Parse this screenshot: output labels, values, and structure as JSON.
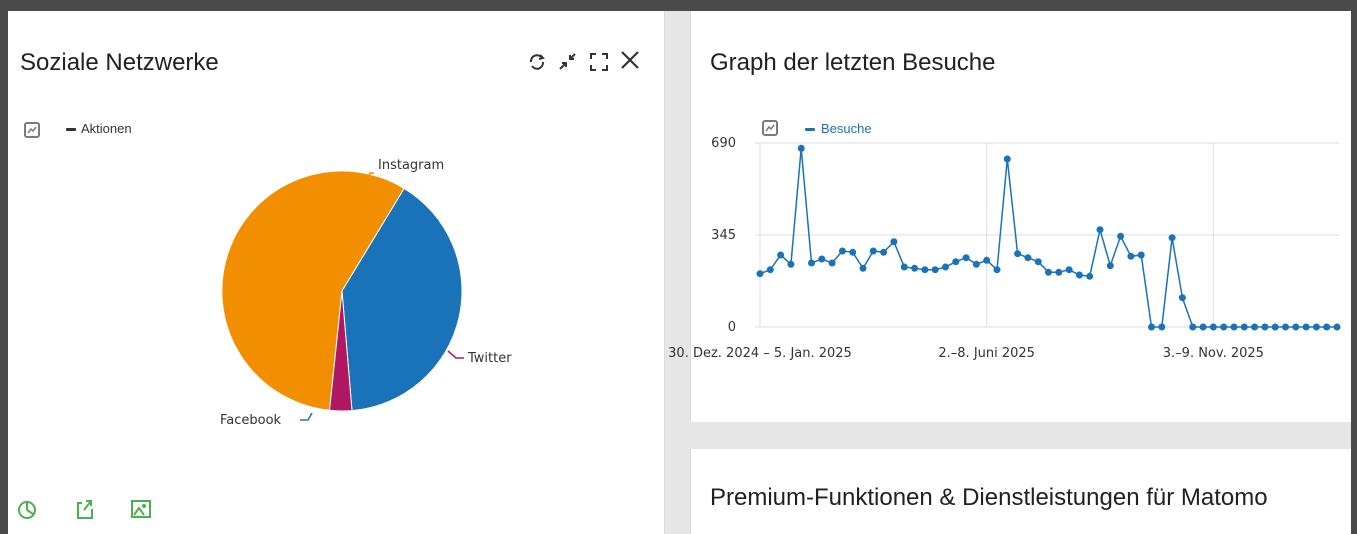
{
  "social": {
    "title": "Soziale Netzwerke",
    "legend_label": "Aktionen",
    "controls": [
      "refresh-icon",
      "minimize-icon",
      "maximize-icon",
      "close-icon"
    ],
    "footer_icons": [
      "pie-chart-icon",
      "export-icon",
      "image-icon"
    ]
  },
  "visits": {
    "title": "Graph der letzten Besuche",
    "legend_label": "Besuche"
  },
  "premium": {
    "title": "Premium-Funktionen & Dienstleistungen für Matomo"
  },
  "colors": {
    "instagram": "#f28f00",
    "facebook": "#1a73b8",
    "twitter": "#b01863",
    "line": "#1a73b8",
    "legend_dark": "#333333",
    "footer_icon": "#4caf50"
  },
  "chart_data": [
    {
      "type": "pie",
      "series_name": "Aktionen",
      "labels": [
        "Instagram",
        "Facebook",
        "Twitter"
      ],
      "values": [
        57,
        40,
        3
      ]
    },
    {
      "type": "line",
      "legend": [
        "Besuche"
      ],
      "series": [
        {
          "name": "Besuche",
          "values": [
            200,
            215,
            270,
            235,
            670,
            240,
            255,
            240,
            285,
            280,
            220,
            285,
            280,
            320,
            225,
            220,
            215,
            215,
            225,
            245,
            260,
            235,
            250,
            215,
            630,
            275,
            260,
            245,
            205,
            205,
            215,
            195,
            190,
            365,
            230,
            340,
            265,
            270,
            0,
            0,
            335,
            110,
            0,
            0,
            0,
            0,
            0,
            0,
            0,
            0,
            0,
            0,
            0,
            0,
            0,
            0,
            0
          ]
        }
      ],
      "y_ticks": [
        "690",
        "345",
        "0"
      ],
      "ylim": [
        0,
        690
      ],
      "x_tick_labels": [
        "30. Dez. 2024 – 5. Jan. 2025",
        "2.–8. Juni 2025",
        "3.–9. Nov. 2025"
      ],
      "x_tick_indices": [
        0,
        22,
        44
      ],
      "grid": true
    }
  ]
}
